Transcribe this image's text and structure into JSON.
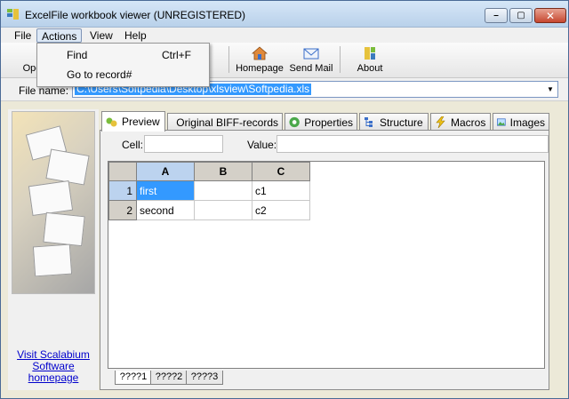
{
  "window": {
    "title": "ExcelFile workbook viewer (UNREGISTERED)",
    "minimize_label": "–",
    "maximize_label": "▢",
    "close_label": "✕"
  },
  "menu": {
    "items": [
      {
        "label": "File"
      },
      {
        "label": "Actions"
      },
      {
        "label": "View"
      },
      {
        "label": "Help"
      }
    ],
    "active": "Actions"
  },
  "actions_menu": {
    "items": [
      {
        "label": "Find",
        "shortcut": "Ctrl+F"
      },
      {
        "label": "Go to record#",
        "shortcut": ""
      }
    ]
  },
  "toolbar": {
    "open_label": "Ope",
    "homepage_label": "Homepage",
    "send_mail_label": "Send Mail",
    "about_label": "About"
  },
  "file": {
    "label": "File name:",
    "value": "C:\\Users\\Softpedia\\Desktop\\xlsview\\Softpedia.xls"
  },
  "left_panel": {
    "link_text": "Visit Scalabium Software homepage"
  },
  "tabs": [
    {
      "label": "Preview",
      "icon": "preview-icon"
    },
    {
      "label": "Original BIFF-records",
      "icon": "grid-icon"
    },
    {
      "label": "Properties",
      "icon": "properties-icon"
    },
    {
      "label": "Structure",
      "icon": "structure-icon"
    },
    {
      "label": "Macros",
      "icon": "lightning-icon"
    },
    {
      "label": "Images",
      "icon": "image-icon"
    }
  ],
  "active_tab": "Preview",
  "preview": {
    "cell_label": "Cell:",
    "cell_value": "",
    "value_label": "Value:",
    "value_value": ""
  },
  "grid": {
    "columns": [
      "A",
      "B",
      "C"
    ],
    "rows": [
      {
        "num": "1",
        "cells": [
          "first",
          "",
          "c1"
        ]
      },
      {
        "num": "2",
        "cells": [
          "second",
          "",
          "c2"
        ]
      }
    ],
    "selected_cell": "A1"
  },
  "sheets": [
    {
      "label": "????1"
    },
    {
      "label": "????2"
    },
    {
      "label": "????3"
    }
  ],
  "colors": {
    "selection": "#3399ff",
    "link": "#0000cc",
    "header_bg": "#d4d0c8"
  }
}
